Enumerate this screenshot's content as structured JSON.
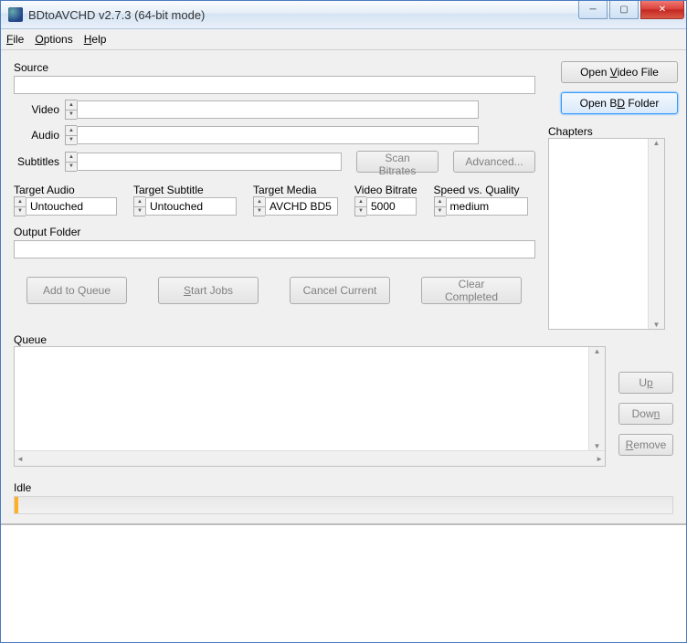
{
  "window": {
    "title": "BDtoAVCHD v2.7.3   (64-bit mode)"
  },
  "menu": {
    "file": "File",
    "options": "Options",
    "help": "Help"
  },
  "labels": {
    "source": "Source",
    "video": "Video",
    "audio": "Audio",
    "subtitles": "Subtitles",
    "target_audio": "Target Audio",
    "target_subtitle": "Target Subtitle",
    "target_media": "Target Media",
    "video_bitrate": "Video Bitrate",
    "speed_quality": "Speed vs. Quality",
    "output_folder": "Output Folder",
    "chapters": "Chapters",
    "queue": "Queue",
    "status": "Idle"
  },
  "fields": {
    "source": "",
    "video": "",
    "audio": "",
    "subtitles": "",
    "target_audio": "Untouched",
    "target_subtitle": "Untouched",
    "target_media": "AVCHD BD5",
    "video_bitrate": "5000",
    "speed_quality": "medium",
    "output_folder": ""
  },
  "buttons": {
    "open_video": "Open Video File",
    "open_bd": "Open BD Folder",
    "scan_bitrates": "Scan Bitrates",
    "advanced": "Advanced...",
    "add_queue": "Add to Queue",
    "start_jobs": "Start Jobs",
    "cancel_current": "Cancel Current",
    "clear_completed": "Clear Completed",
    "up": "Up",
    "down": "Down",
    "remove": "Remove"
  }
}
